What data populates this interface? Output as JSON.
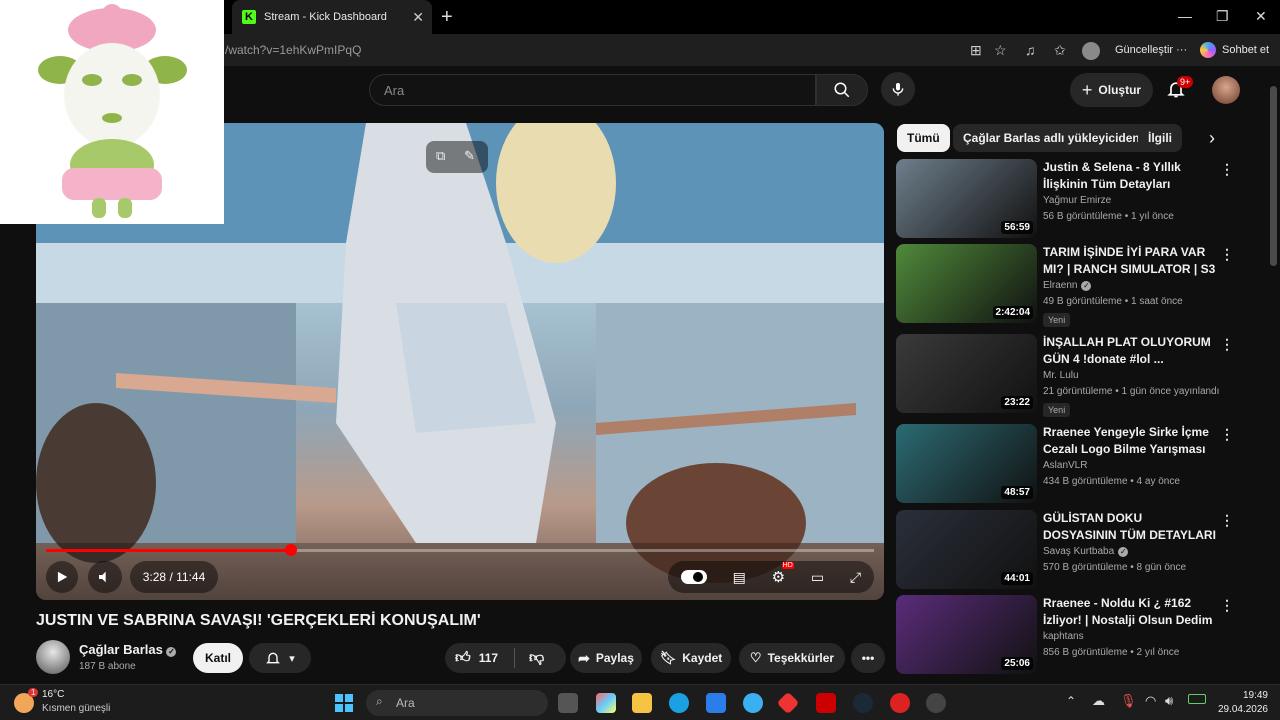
{
  "browser": {
    "tab_title": "Stream - Kick Dashboard",
    "url": "/watch?v=1ehKwPmIPqQ",
    "update_label": "Güncelleştir",
    "more_label": "···",
    "chat_label": "Sohbet et"
  },
  "header": {
    "search_placeholder": "Ara",
    "create_label": "Oluştur",
    "notif_badge": "9+"
  },
  "player": {
    "time": "3:28 / 11:44",
    "progress_fraction": 0.296,
    "hd_badge": "HD"
  },
  "video": {
    "title": "JUSTIN VE SABRINA SAVAŞI! 'GERÇEKLERİ KONUŞALIM'",
    "channel": "Çağlar Barlas",
    "subscribers": "187 B abone",
    "join_label": "Katıl",
    "likes": "117",
    "share_label": "Paylaş",
    "save_label": "Kaydet",
    "thanks_label": "Teşekkürler"
  },
  "chips": [
    "Tümü",
    "Çağlar Barlas adlı yükleyiciden",
    "İlgili"
  ],
  "recommendations": [
    {
      "title": "Justin & Selena - 8 Yıllık İlişkinin Tüm Detayları",
      "channel": "Yağmur Emirze",
      "meta": "56 B görüntüleme • 1 yıl önce",
      "duration": "56:59",
      "verified": false,
      "new": "",
      "color": "#6e7f8c"
    },
    {
      "title": "TARIM İŞİNDE İYİ PARA VAR MI? | RANCH SIMULATOR | S3 ...",
      "channel": "Elraenn",
      "meta": "49 B görüntüleme • 1 saat önce",
      "duration": "2:42:04",
      "verified": true,
      "new": "Yeni",
      "color": "#4f8a3a"
    },
    {
      "title": "İNŞALLAH PLAT OLUYORUM GÜN 4 !donate #lol ...",
      "channel": "Mr. Lulu",
      "meta": "21 görüntüleme • 1 gün önce yayınlandı",
      "duration": "23:22",
      "verified": false,
      "new": "Yeni",
      "color": "#3a3a3a"
    },
    {
      "title": "Rraenee Yengeyle Sirke İçme Cezalı Logo Bilme Yarışması ...",
      "channel": "AslanVLR",
      "meta": "434 B görüntüleme • 4 ay önce",
      "duration": "48:57",
      "verified": false,
      "new": "",
      "color": "#2b6b73"
    },
    {
      "title": "GÜLİSTAN DOKU DOSYASININ TÜM DETAYLARI | Savaş ...",
      "channel": "Savaş Kurtbaba",
      "meta": "570 B görüntüleme • 8 gün önce",
      "duration": "44:01",
      "verified": true,
      "new": "",
      "color": "#2a2f3a"
    },
    {
      "title": "Rraenee - Noldu Ki ¿ #162 İzliyor! | Nostalji Olsun Dedim",
      "channel": "kaphtans",
      "meta": "856 B görüntüleme • 2 yıl önce",
      "duration": "25:06",
      "verified": false,
      "new": "",
      "color": "#5a2c7a"
    }
  ],
  "taskbar": {
    "temp": "16°C",
    "weather": "Kısmen güneşli",
    "weather_badge": "1",
    "search_placeholder": "Ara",
    "time": "19:49",
    "date": "29.04.2026"
  }
}
